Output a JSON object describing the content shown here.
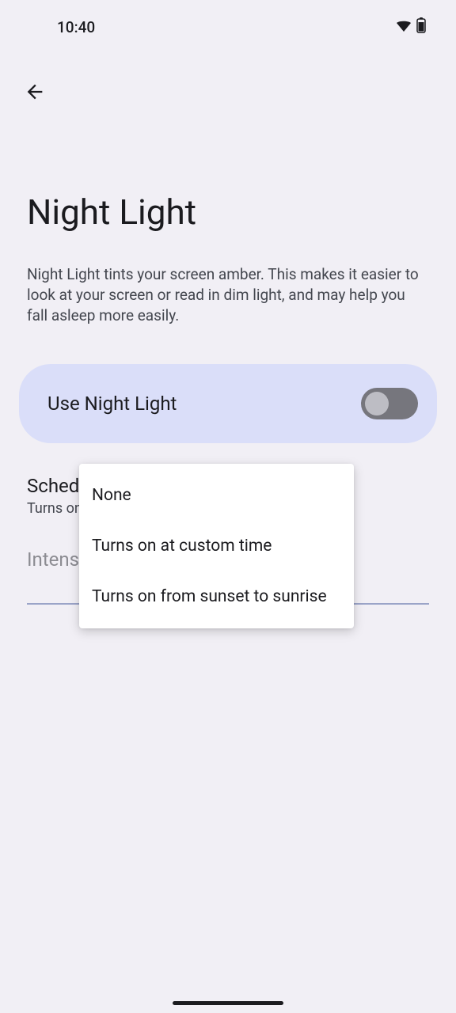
{
  "status": {
    "time": "10:40"
  },
  "page": {
    "title": "Night Light",
    "description": "Night Light tints your screen amber. This makes it easier to look at your screen or read in dim light, and may help you fall asleep more easily."
  },
  "toggle": {
    "label": "Use Night Light",
    "on": false
  },
  "schedule": {
    "title": "Schedule",
    "subtitle": "Turns on"
  },
  "intensity": {
    "title": "Intensity"
  },
  "popup": {
    "items": [
      "None",
      "Turns on at custom time",
      "Turns on from sunset to sunrise"
    ]
  }
}
